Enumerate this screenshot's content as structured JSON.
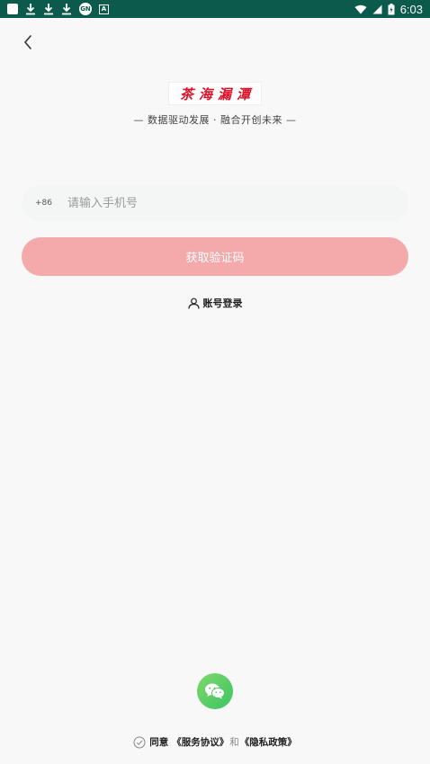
{
  "status_bar": {
    "time": "6:03",
    "badge_text": "GN",
    "a_text": "A"
  },
  "logo": {
    "text": "茶海漏潭"
  },
  "slogan": "— 数据驱动发展 · 融合开创未来 —",
  "phone": {
    "country_code": "+86",
    "placeholder": "请输入手机号",
    "value": ""
  },
  "get_code_label": "获取验证码",
  "account_login_label": "账号登录",
  "agreement": {
    "agree": "同意",
    "service": "《服务协议》",
    "and": "和",
    "privacy": "《隐私政策》"
  },
  "colors": {
    "status_bar": "#0b5a4c",
    "primary_button": "#f4aaab",
    "logo_red": "#d9142a",
    "wechat_green": "#3cc463"
  },
  "icons": {
    "back": "chevron-left-icon",
    "user": "user-icon",
    "wechat": "wechat-icon",
    "check": "check-circle-icon"
  }
}
